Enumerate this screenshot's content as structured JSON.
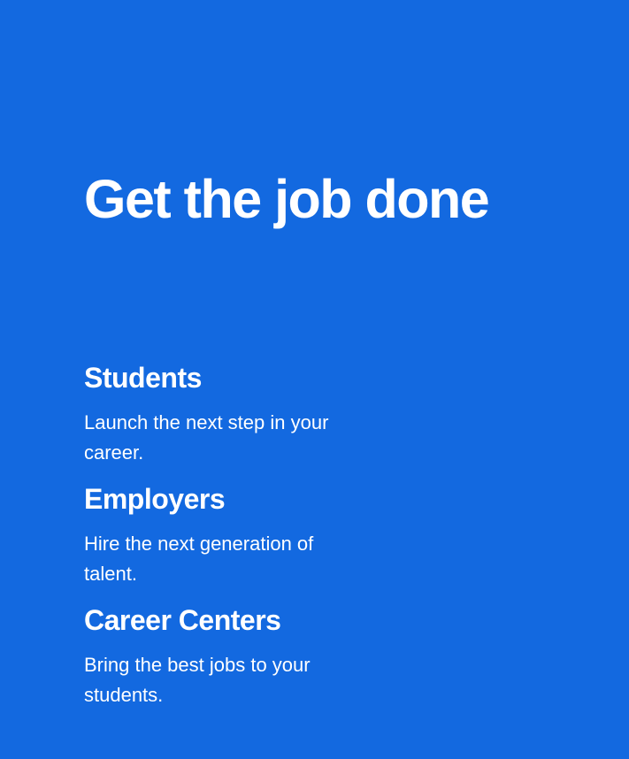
{
  "hero": {
    "headline": "Get the job done",
    "background_color": "#1369e0",
    "text_color": "#ffffff"
  },
  "audiences": [
    {
      "title": "Students",
      "description": "Launch the next step in your career."
    },
    {
      "title": "Employers",
      "description": "Hire the next generation of talent."
    },
    {
      "title": "Career Centers",
      "description": "Bring the best jobs to your students."
    }
  ]
}
